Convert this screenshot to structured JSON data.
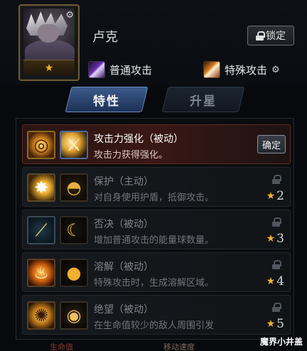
{
  "header": {
    "hero_name": "卢克",
    "lock_label": "锁定",
    "portrait_stars": 1,
    "normal_attack_label": "普通攻击",
    "special_attack_label": "特殊攻击"
  },
  "tabs": [
    {
      "label": "特性",
      "active": true
    },
    {
      "label": "升星",
      "active": false
    }
  ],
  "traits": [
    {
      "name": "攻击力强化（被动）",
      "desc": "攻击力获得强化。",
      "state": "active",
      "button_label": "确定",
      "icons": [
        "target-burst-icon",
        "golden-sword-icon"
      ]
    },
    {
      "name": "保护（主动）",
      "desc": "对自身使用护盾，抵御攻击。",
      "state": "locked",
      "rank": "2",
      "icons": [
        "energy-burst-icon",
        "golden-dome-shield-icon"
      ]
    },
    {
      "name": "否决（被动）",
      "desc": "增加普通攻击的能量球数量。",
      "state": "locked",
      "rank": "3",
      "icons": [
        "triple-slash-icon",
        "crescent-moon-icon"
      ]
    },
    {
      "name": "溶解（被动）",
      "desc": "特殊攻击时，生成溶解区域。",
      "state": "locked",
      "rank": "4",
      "icons": [
        "flame-icon",
        "orbs-icon"
      ]
    },
    {
      "name": "绝望（被动）",
      "desc": "在生命值较少的敌人周围引发",
      "state": "locked",
      "rank": "5",
      "icons": [
        "radiant-figure-icon",
        "eye-icon"
      ]
    }
  ],
  "bottom": {
    "left_text": "生命值",
    "mid_text": "移动速度"
  },
  "watermark": "魔界小井盖",
  "colors": {
    "accent_gold": "#f2b42a",
    "tab_active": "#3c5a8a",
    "active_row": "#3a1714"
  }
}
